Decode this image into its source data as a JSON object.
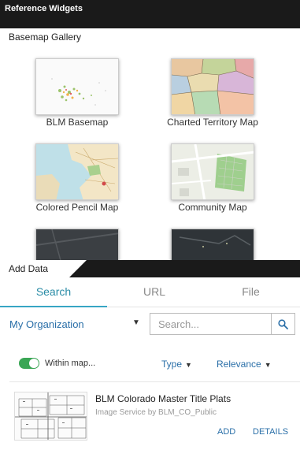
{
  "window": {
    "title": "Reference Widgets"
  },
  "basemap": {
    "panel_title": "Basemap Gallery",
    "items": [
      {
        "label": "BLM Basemap"
      },
      {
        "label": "Charted Territory Map"
      },
      {
        "label": "Colored Pencil Map"
      },
      {
        "label": "Community Map"
      },
      {
        "label": ""
      },
      {
        "label": ""
      }
    ]
  },
  "add_data": {
    "panel_title": "Add Data",
    "tabs": [
      "Search",
      "URL",
      "File"
    ],
    "scope": {
      "selected": "My Organization"
    },
    "search": {
      "placeholder": "Search..."
    },
    "filters": {
      "within_map_label": "Within map...",
      "within_map_on": true,
      "type_label": "Type",
      "sort_label": "Relevance"
    },
    "results": [
      {
        "title": "BLM Colorado Master Title Plats",
        "subtitle": "Image Service by BLM_CO_Public",
        "add_label": "ADD",
        "details_label": "DETAILS"
      }
    ]
  },
  "colors": {
    "accent": "#37a6c4",
    "link": "#2a6fa8",
    "toggle_on": "#3aa655",
    "header": "#1a1a1a"
  },
  "icons": {
    "search": "search-icon",
    "dropdown": "caret-down-icon"
  }
}
